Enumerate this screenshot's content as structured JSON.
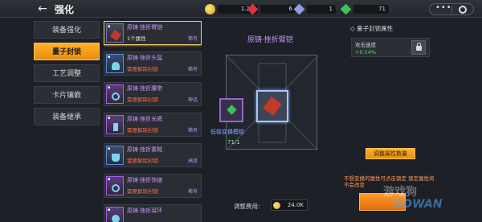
{
  "header": {
    "title": "强化",
    "back_icon": "back-arrow-icon"
  },
  "resources": [
    {
      "icon": "coin-plus-icon",
      "value": "1.2M"
    },
    {
      "icon": "red-cube-icon",
      "value": "6"
    },
    {
      "icon": "blue-cube-icon",
      "value": "1"
    },
    {
      "icon": "green-cube-icon",
      "value": "71"
    }
  ],
  "capsule": {
    "more": "•••"
  },
  "menu": [
    {
      "label": "装备强化",
      "active": false
    },
    {
      "label": "量子封锁",
      "active": true
    },
    {
      "label": "工艺调整",
      "active": false
    },
    {
      "label": "卡片镶嵌",
      "active": false
    },
    {
      "label": "装备继承",
      "active": false
    }
  ],
  "items": [
    {
      "name": "原铸·挫折臂铠",
      "sub": "1个属性",
      "rarity": "稀有",
      "selected": true
    },
    {
      "name": "原铸·挫折头盔",
      "sub": "需要解除封锁",
      "rarity": "稀有",
      "selected": false
    },
    {
      "name": "原铸·挫折腰带",
      "sub": "需要解除封锁",
      "rarity": "神话",
      "selected": false
    },
    {
      "name": "原铸·挫折长裤",
      "sub": "需要解除封锁",
      "rarity": "稀有",
      "selected": false
    },
    {
      "name": "原铸·挫折重靴",
      "sub": "需要解除封锁",
      "rarity": "高级",
      "selected": false
    },
    {
      "name": "原铸·挫折饰链",
      "sub": "需要解除封锁",
      "rarity": "稀有",
      "selected": false
    },
    {
      "name": "原铸·挫折耳环",
      "sub": "",
      "rarity": "",
      "selected": false
    }
  ],
  "center": {
    "title": "原铸·挫折臂铠",
    "lowest_label": "低级变换模组",
    "lowest_count": "71/1"
  },
  "cost": {
    "label": "调整费用:",
    "value": "24.0K"
  },
  "right": {
    "heading": "◇ 量子封锁属性",
    "attr_name": "攻击速度",
    "attr_value": "+0.54%",
    "adjust_label": "调整属性数量",
    "hint": "不想变换的属性可点击锁定 锁定属性将不会改变"
  },
  "watermark": {
    "line1": "游戏狗",
    "line2": "GDWAN"
  },
  "colors": {
    "accent": "#ffb12b",
    "selected_border": "#f3d56a",
    "attr_value": "#58d86a"
  }
}
